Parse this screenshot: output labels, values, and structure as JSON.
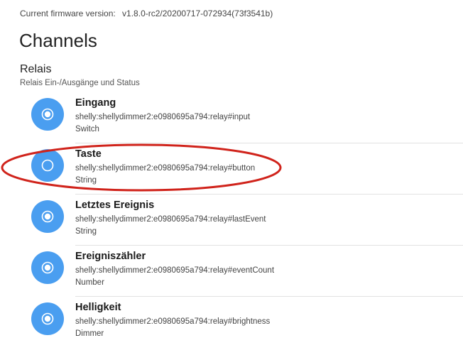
{
  "firmware": {
    "label": "Current firmware version:",
    "version": "v1.8.0-rc2/20200717-072934(73f3541b)"
  },
  "page": {
    "title": "Channels"
  },
  "section": {
    "title": "Relais",
    "description": "Relais Ein-/Ausgänge und Status"
  },
  "channels": [
    {
      "name": "Eingang",
      "uid": "shelly:shellydimmer2:e0980695a794:relay#input",
      "type": "Switch",
      "icon": "radio-checked-icon",
      "linked": true
    },
    {
      "name": "Taste",
      "uid": "shelly:shellydimmer2:e0980695a794:relay#button",
      "type": "String",
      "icon": "radio-unchecked-icon",
      "linked": false
    },
    {
      "name": "Letztes Ereignis",
      "uid": "shelly:shellydimmer2:e0980695a794:relay#lastEvent",
      "type": "String",
      "icon": "radio-checked-icon",
      "linked": true
    },
    {
      "name": "Ereigniszähler",
      "uid": "shelly:shellydimmer2:e0980695a794:relay#eventCount",
      "type": "Number",
      "icon": "radio-checked-icon",
      "linked": true
    },
    {
      "name": "Helligkeit",
      "uid": "shelly:shellydimmer2:e0980695a794:relay#brightness",
      "type": "Dimmer",
      "icon": "radio-checked-icon",
      "linked": true
    }
  ],
  "colors": {
    "accent": "#4a9ef0",
    "highlight": "#d0231b"
  }
}
